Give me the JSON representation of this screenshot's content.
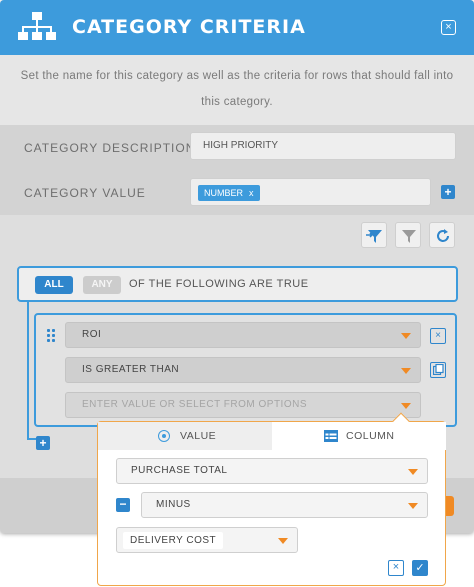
{
  "header": {
    "title": "CATEGORY CRITERIA",
    "close_glyph": "×",
    "logo_icon": "hierarchy-icon"
  },
  "description": "Set the name for this category as well as the criteria for rows that should fall into this category.",
  "form": {
    "description_label": "CATEGORY DESCRIPTION",
    "description_value": "HIGH PRIORITY",
    "value_label": "CATEGORY VALUE",
    "value_chip": "NUMBER",
    "value_chip_remove": "x",
    "add_glyph": "+"
  },
  "toolbar": {
    "icons": [
      "filter-apply-icon",
      "filter-icon",
      "refresh-icon"
    ]
  },
  "group": {
    "all_label": "ALL",
    "any_label": "ANY",
    "text": "OF THE FOLLOWING ARE TRUE",
    "add_glyph": "+"
  },
  "rule": {
    "field": "ROI",
    "operator": "IS GREATER THAN",
    "value_placeholder": "ENTER VALUE OR SELECT FROM OPTIONS",
    "remove_glyph": "×",
    "copy_icon": "copy-icon"
  },
  "popover": {
    "tab_value": "VALUE",
    "tab_column": "COLUMN",
    "column_select": "PURCHASE TOTAL",
    "operator_select": "MINUS",
    "second_column": "DELIVERY COST",
    "minus_glyph": "−",
    "cancel_glyph": "×",
    "confirm_glyph": "✓"
  },
  "colors": {
    "accent": "#3d9bdc",
    "accent_dark": "#2f86cc",
    "orange": "#f08a24"
  }
}
